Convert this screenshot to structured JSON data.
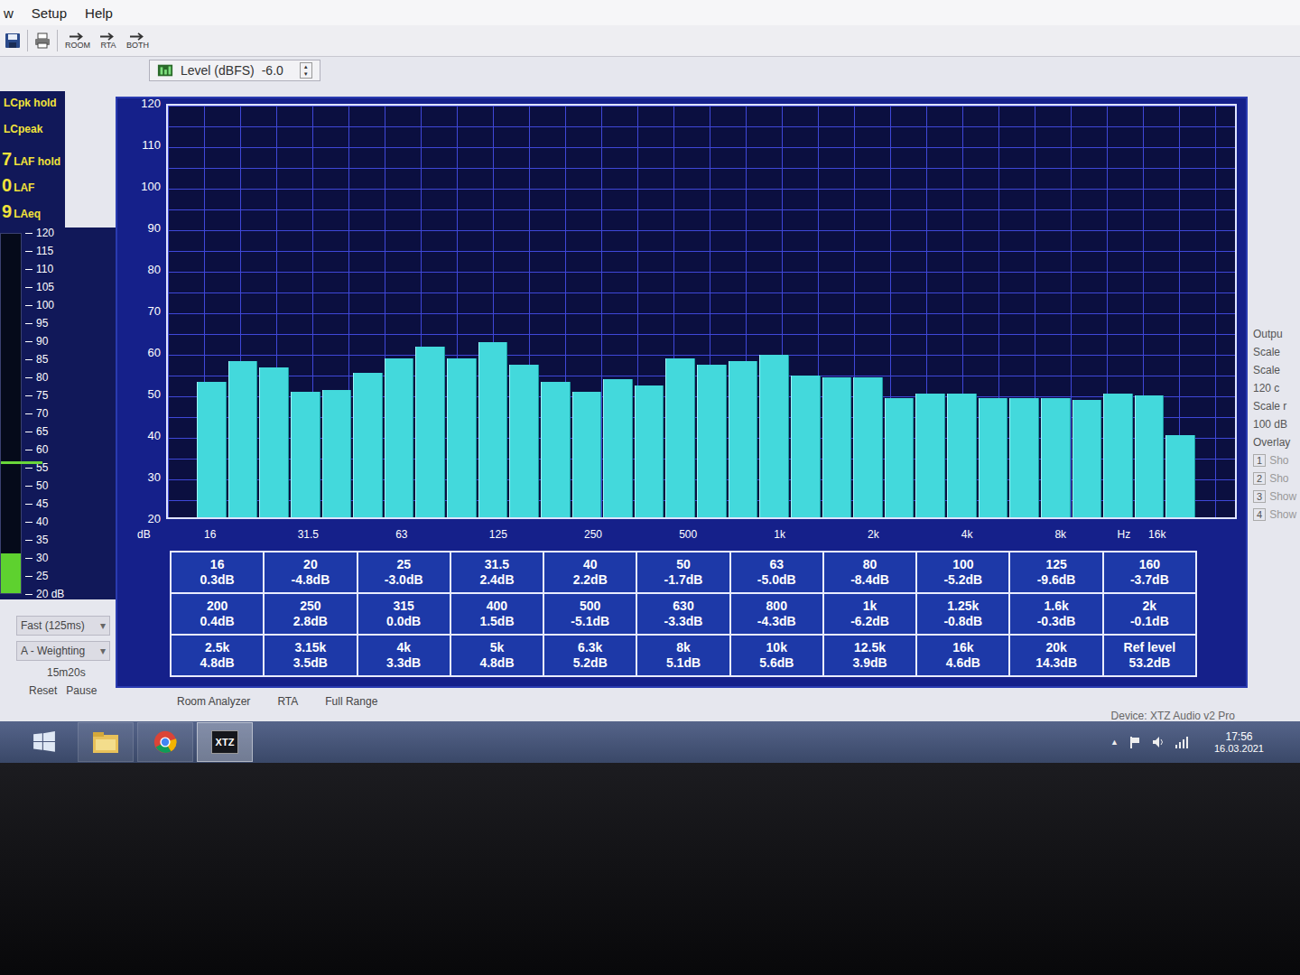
{
  "menu": [
    "w",
    "Setup",
    "Help"
  ],
  "toolbar": {
    "buttons": [
      {
        "label": "ROOM"
      },
      {
        "label": "RTA"
      },
      {
        "label": "BOTH"
      }
    ]
  },
  "level_control": {
    "label": "Level (dBFS)",
    "value": "-6.0",
    "up": "▲",
    "down": "▼"
  },
  "meters": {
    "readouts": [
      {
        "value": "",
        "label": "LCpk hold"
      },
      {
        "value": "",
        "label": "LCpeak"
      },
      {
        "value": "7",
        "label": "LAF hold"
      },
      {
        "value": "0",
        "label": "LAF"
      },
      {
        "value": "9",
        "label": "LAeq"
      }
    ],
    "scale": [
      "120",
      "115",
      "110",
      "105",
      "100",
      "95",
      "90",
      "85",
      "80",
      "75",
      "70",
      "65",
      "60",
      "55",
      "50",
      "45",
      "40",
      "35",
      "30",
      "25",
      "20 dB"
    ],
    "level": 0.11,
    "hold_level": 0.36
  },
  "controls": {
    "response": "Fast (125ms)",
    "weighting": "A - Weighting",
    "elapsed": "15m20s",
    "buttons": [
      "Reset",
      "Pause"
    ],
    "caret": "▾"
  },
  "chart": {
    "y_axis_label": "dB",
    "y_min": 20,
    "y_max": 120,
    "y_ticks": [
      "120",
      "110",
      "100",
      "90",
      "80",
      "70",
      "60",
      "50",
      "40",
      "30",
      "20"
    ],
    "bands": [
      {
        "freq": "16",
        "tick": "16",
        "db": 53,
        "correction": "0.3dB"
      },
      {
        "freq": "20",
        "tick": "",
        "db": 58,
        "correction": "-4.8dB"
      },
      {
        "freq": "25",
        "tick": "",
        "db": 56.5,
        "correction": "-3.0dB"
      },
      {
        "freq": "31.5",
        "tick": "31.5",
        "db": 50.5,
        "correction": "2.4dB"
      },
      {
        "freq": "40",
        "tick": "",
        "db": 51,
        "correction": "2.2dB"
      },
      {
        "freq": "50",
        "tick": "",
        "db": 55,
        "correction": "-1.7dB"
      },
      {
        "freq": "63",
        "tick": "63",
        "db": 58.5,
        "correction": "-5.0dB"
      },
      {
        "freq": "80",
        "tick": "",
        "db": 61.5,
        "correction": "-8.4dB"
      },
      {
        "freq": "100",
        "tick": "",
        "db": 58.5,
        "correction": "-5.2dB"
      },
      {
        "freq": "125",
        "tick": "125",
        "db": 62.5,
        "correction": "-9.6dB"
      },
      {
        "freq": "160",
        "tick": "",
        "db": 57,
        "correction": "-3.7dB"
      },
      {
        "freq": "200",
        "tick": "",
        "db": 53,
        "correction": "0.4dB"
      },
      {
        "freq": "250",
        "tick": "250",
        "db": 50.5,
        "correction": "2.8dB"
      },
      {
        "freq": "315",
        "tick": "",
        "db": 53.5,
        "correction": "0.0dB"
      },
      {
        "freq": "400",
        "tick": "",
        "db": 52,
        "correction": "1.5dB"
      },
      {
        "freq": "500",
        "tick": "500",
        "db": 58.5,
        "correction": "-5.1dB"
      },
      {
        "freq": "630",
        "tick": "",
        "db": 57,
        "correction": "-3.3dB"
      },
      {
        "freq": "800",
        "tick": "",
        "db": 58,
        "correction": "-4.3dB"
      },
      {
        "freq": "1k",
        "tick": "1k",
        "db": 59.5,
        "correction": "-6.2dB"
      },
      {
        "freq": "1.25k",
        "tick": "",
        "db": 54.5,
        "correction": "-0.8dB"
      },
      {
        "freq": "1.6k",
        "tick": "",
        "db": 54,
        "correction": "-0.3dB"
      },
      {
        "freq": "2k",
        "tick": "2k",
        "db": 54,
        "correction": "-0.1dB"
      },
      {
        "freq": "2.5k",
        "tick": "",
        "db": 49,
        "correction": "4.8dB"
      },
      {
        "freq": "3.15k",
        "tick": "",
        "db": 50,
        "correction": "3.5dB"
      },
      {
        "freq": "4k",
        "tick": "4k",
        "db": 50,
        "correction": "3.3dB"
      },
      {
        "freq": "5k",
        "tick": "",
        "db": 49,
        "correction": "4.8dB"
      },
      {
        "freq": "6.3k",
        "tick": "",
        "db": 49,
        "correction": "5.2dB"
      },
      {
        "freq": "8k",
        "tick": "8k",
        "db": 49,
        "correction": "5.1dB"
      },
      {
        "freq": "10k",
        "tick": "",
        "db": 48.5,
        "correction": "5.6dB"
      },
      {
        "freq": "12.5k",
        "tick": "Hz",
        "db": 50,
        "correction": "3.9dB"
      },
      {
        "freq": "16k",
        "tick": "16k",
        "db": 49.5,
        "correction": "4.6dB"
      },
      {
        "freq": "20k",
        "tick": "",
        "db": 40,
        "correction": "14.3dB"
      }
    ],
    "ref_level": {
      "label": "Ref level",
      "value": "53.2dB"
    }
  },
  "side_panel": {
    "lines": [
      "Outpu",
      "Scale",
      "Scale",
      "120 c",
      "Scale r",
      "100 dB",
      "Overlay"
    ],
    "overlays": [
      {
        "num": "1",
        "label": "Sho"
      },
      {
        "num": "2",
        "label": "Sho"
      },
      {
        "num": "3",
        "label": "Show"
      },
      {
        "num": "4",
        "label": "Show"
      }
    ]
  },
  "status_bar": {
    "tabs": [
      "Room Analyzer",
      "RTA",
      "Full Range"
    ],
    "device": "Device: XTZ Audio v2 Pro"
  },
  "taskbar": {
    "app_label": "XTZ",
    "app_active": true,
    "tray_arrow": "▲",
    "time": "17:56",
    "date": "16.03.2021"
  }
}
